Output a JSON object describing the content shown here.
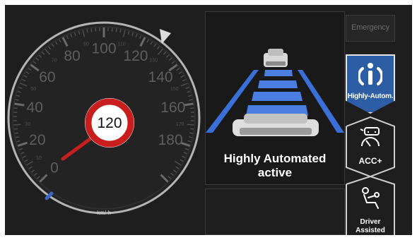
{
  "speedometer": {
    "major_labels": [
      "0",
      "20",
      "40",
      "60",
      "80",
      "100",
      "120",
      "140",
      "160",
      "180"
    ],
    "minor_labels": [
      "10",
      "30",
      "50",
      "70",
      "90",
      "110",
      "130",
      "150",
      "170"
    ],
    "unit": "km/ h",
    "current_speed": 0,
    "max_speed": 200,
    "speed_limit": "120",
    "colors": {
      "ring": "#b4b4b4",
      "needle": "#c81e1e",
      "limit_sign_border": "#c81e1e",
      "start_marker": "#3a66c8"
    }
  },
  "status": {
    "line1": "Highly Automated",
    "line2": "active"
  },
  "modes": {
    "emergency": {
      "label": "Emergency",
      "active": false,
      "icon": "emergency-label"
    },
    "highly_automated": {
      "label": "Highly-Autom.",
      "active": true,
      "icon": "automation-i-icon"
    },
    "acc": {
      "label": "ACC+",
      "active": false,
      "icon": "acc-car-gauge-icon"
    },
    "driver_assisted": {
      "line1": "Driver",
      "line2": "Assisted",
      "active": false,
      "icon": "driver-seat-icon"
    }
  },
  "colors": {
    "active_mode": "#2c5da5",
    "lane_blue": "#3a6fd8",
    "background": "#1e1e1e"
  }
}
